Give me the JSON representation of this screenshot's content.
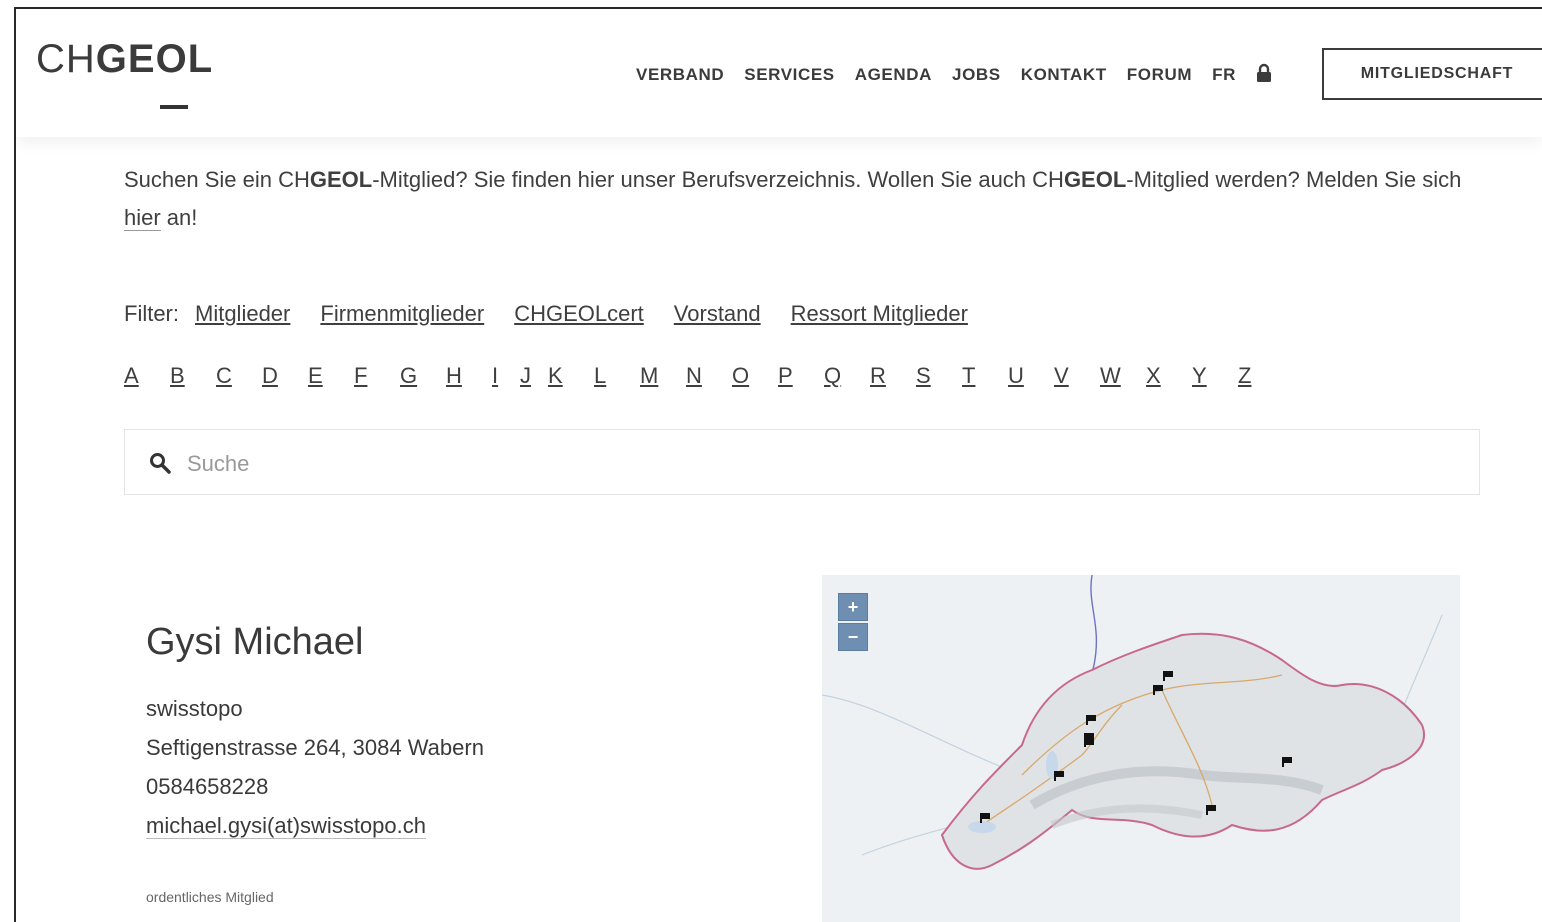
{
  "logo": {
    "light": "CH",
    "bold": "GEOL"
  },
  "nav": {
    "items": [
      "VERBAND",
      "SERVICES",
      "AGENDA",
      "JOBS",
      "KONTAKT",
      "FORUM",
      "FR"
    ],
    "membership_button": "MITGLIEDSCHAFT"
  },
  "intro": {
    "part1": "Suchen Sie ein CH",
    "bold1": "GEOL",
    "part2": "-Mitglied? Sie finden hier unser Berufsverzeichnis. Wollen Sie auch CH",
    "bold2": "GEOL",
    "part3": "-Mitglied werden? Melden Sie sich ",
    "link": "hier",
    "part4": " an!"
  },
  "filter": {
    "label": "Filter:",
    "links": [
      "Mitglieder",
      "Firmenmitglieder",
      "CHGEOLcert",
      "Vorstand",
      "Ressort Mitglieder"
    ]
  },
  "alphabet": [
    "A",
    "B",
    "C",
    "D",
    "E",
    "F",
    "G",
    "H",
    "I",
    "J",
    "K",
    "L",
    "M",
    "N",
    "O",
    "P",
    "Q",
    "R",
    "S",
    "T",
    "U",
    "V",
    "W",
    "X",
    "Y",
    "Z"
  ],
  "search": {
    "placeholder": "Suche",
    "value": ""
  },
  "member": {
    "name": "Gysi Michael",
    "organization": "swisstopo",
    "address": "Seftigenstrasse 264, 3084 Wabern",
    "phone": "0584658228",
    "email": "michael.gysi(at)swisstopo.ch",
    "type": "ordentliches Mitglied"
  },
  "map": {
    "zoom_in": "+",
    "zoom_out": "−"
  },
  "colors": {
    "text": "#3a3a3a",
    "border": "#2a2a2a",
    "map_zoom": "#6f8fb2",
    "map_border": "#c8688f"
  }
}
